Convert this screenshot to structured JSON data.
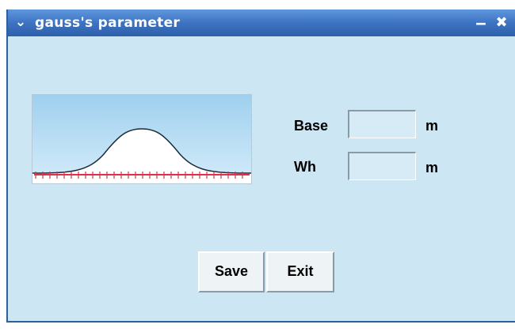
{
  "window": {
    "title": "gauss's parameter",
    "menu_icon": "chevron-down-icon",
    "minimize_icon": "minimize-icon",
    "close_icon": "close-icon"
  },
  "form": {
    "base": {
      "label": "Base",
      "value": "",
      "unit": "m"
    },
    "wh": {
      "label": "Wh",
      "value": "",
      "unit": "m"
    }
  },
  "buttons": {
    "save": "Save",
    "exit": "Exit"
  },
  "colors": {
    "window_bg": "#cde6f3",
    "titlebar": "#3d73c2",
    "preview_sky": "#b7dcf3",
    "preview_curve": "#1a2a3a",
    "preview_axis": "#e0304a"
  }
}
